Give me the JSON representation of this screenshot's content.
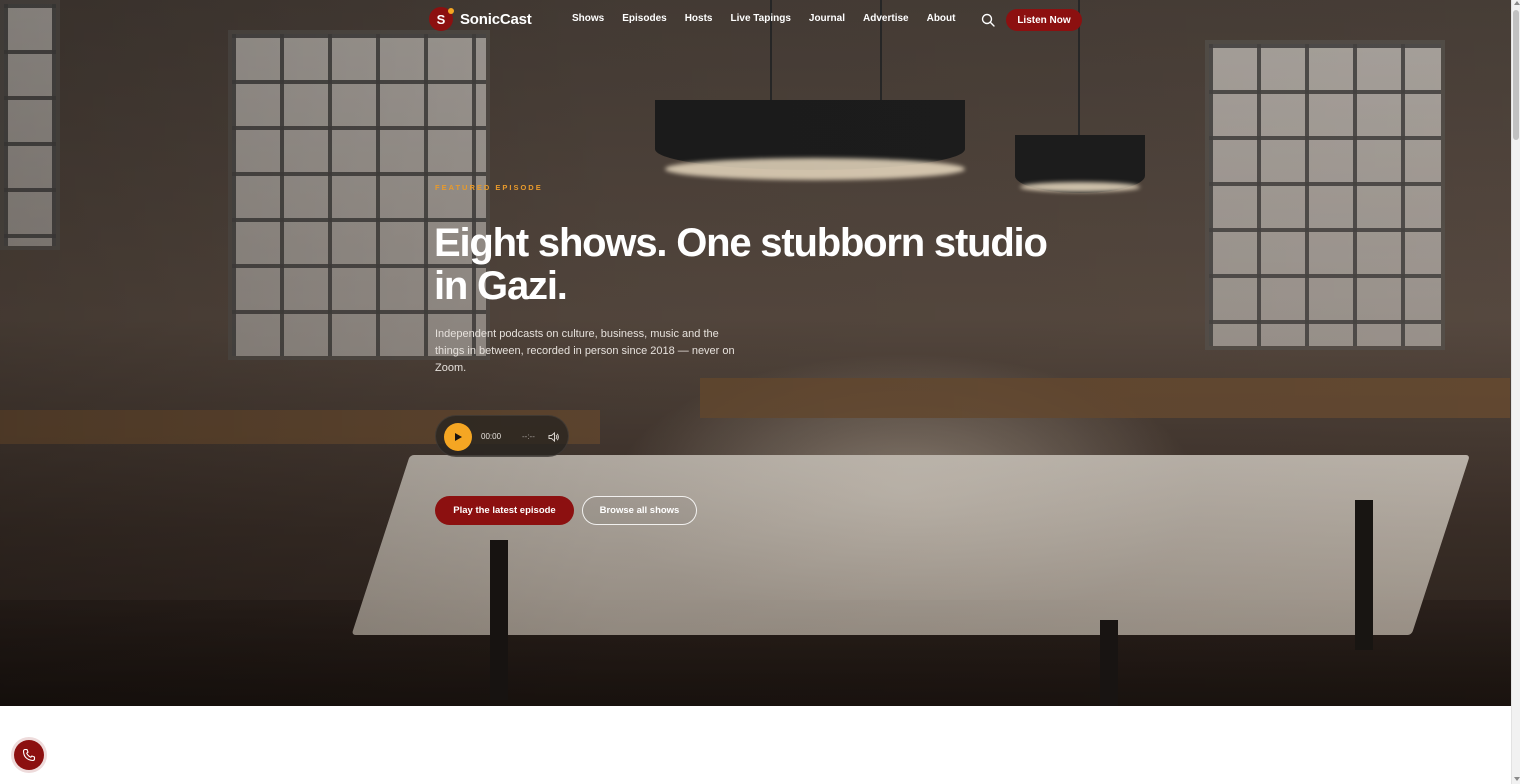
{
  "brand": {
    "logo_letter": "S",
    "name": "SonicCast",
    "accent_color": "#8c1010",
    "highlight_color": "#f5a623"
  },
  "nav": {
    "items": [
      "Shows",
      "Episodes",
      "Hosts",
      "Live Tapings",
      "Journal",
      "Advertise",
      "About"
    ],
    "search_icon": "search-icon",
    "cta_label": "Listen Now"
  },
  "hero": {
    "eyebrow": "FEATURED EPISODE",
    "headline": "Eight shows. One stubborn studio in Gazi.",
    "intro": "Independent podcasts on culture, business, music and the things in between, recorded in person since 2018 — never on Zoom.",
    "player": {
      "play_icon": "play-icon",
      "current_time": "00:00",
      "duration": "--:--",
      "volume_icon": "volume-icon"
    },
    "primary_button": "Play the latest episode",
    "secondary_button": "Browse all shows"
  },
  "floating": {
    "call_icon": "phone-icon"
  }
}
